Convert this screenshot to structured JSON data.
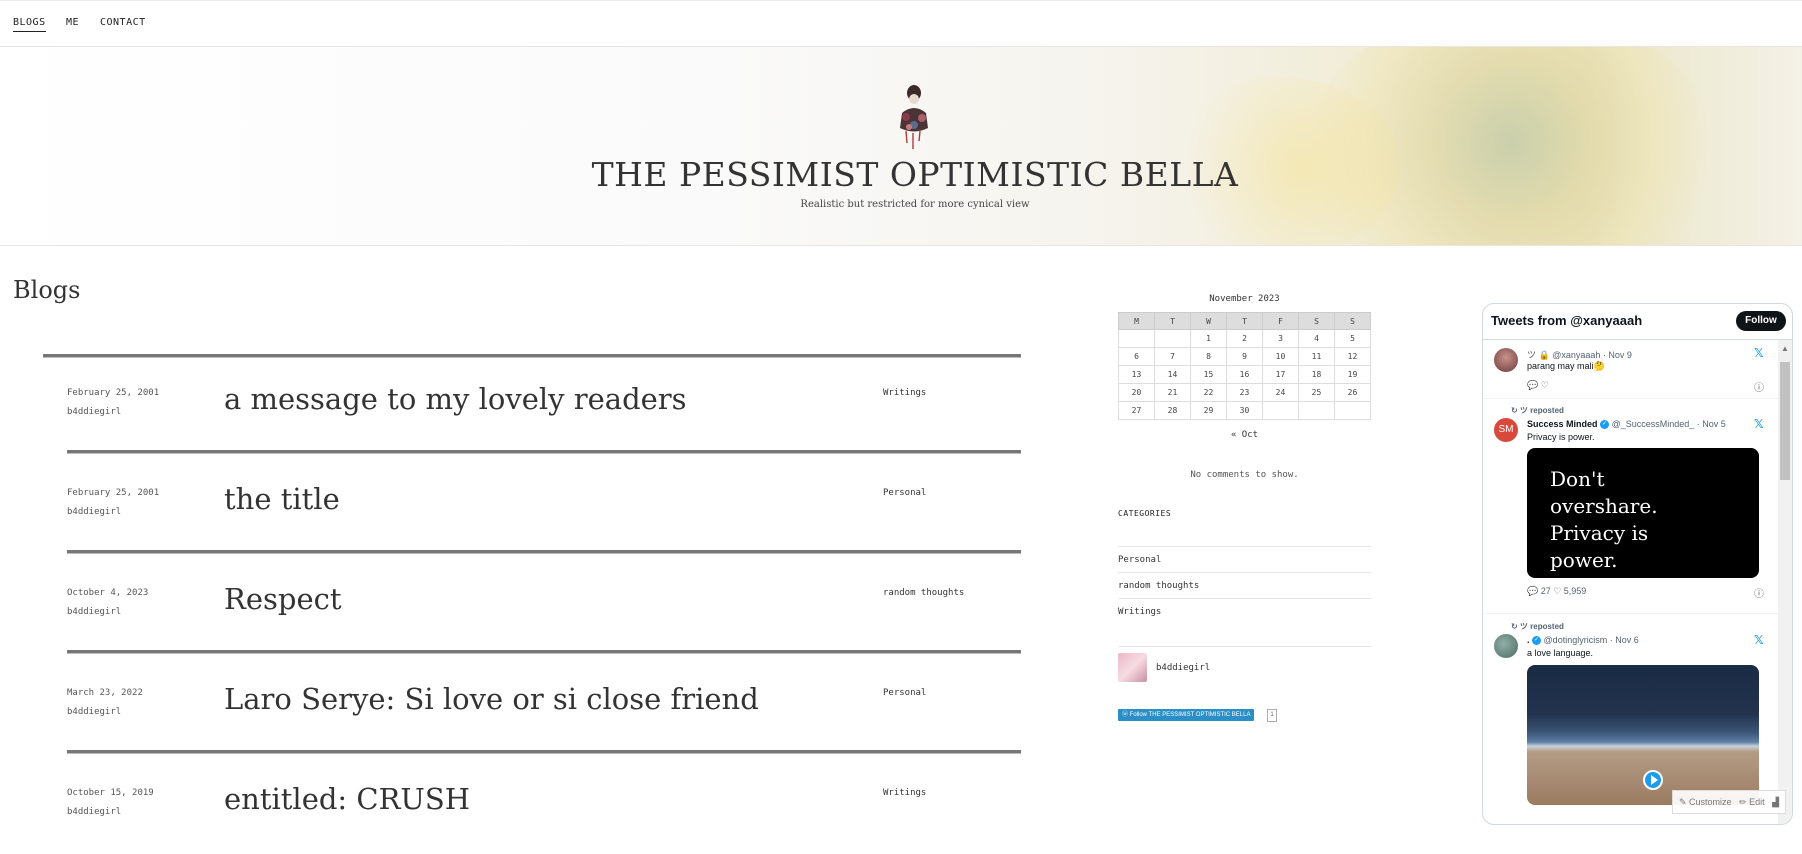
{
  "nav": {
    "items": [
      {
        "label": "BLOGS",
        "active": true
      },
      {
        "label": "ME",
        "active": false
      },
      {
        "label": "CONTACT",
        "active": false
      }
    ]
  },
  "site": {
    "title": "THE PESSIMIST OPTIMISTIC BELLA",
    "tagline": "Realistic but restricted for more cynical view"
  },
  "main": {
    "heading": "Blogs",
    "posts": [
      {
        "date": "February 25, 2001",
        "author": "b4ddiegirl",
        "title": "a message to my lovely readers",
        "category": "Writings"
      },
      {
        "date": "February 25, 2001",
        "author": "b4ddiegirl",
        "title": "the title",
        "category": "Personal"
      },
      {
        "date": "October 4, 2023",
        "author": "b4ddiegirl",
        "title": "Respect",
        "category": "random thoughts"
      },
      {
        "date": "March 23, 2022",
        "author": "b4ddiegirl",
        "title": "Laro Serye: Si love or si close friend",
        "category": "Personal"
      },
      {
        "date": "October 15, 2019",
        "author": "b4ddiegirl",
        "title": "entitled: CRUSH",
        "category": "Writings"
      }
    ]
  },
  "sidebar": {
    "calendar": {
      "caption": "November 2023",
      "weekdays": [
        "M",
        "T",
        "W",
        "T",
        "F",
        "S",
        "S"
      ],
      "weeks": [
        [
          "",
          "",
          "1",
          "2",
          "3",
          "4",
          "5"
        ],
        [
          "6",
          "7",
          "8",
          "9",
          "10",
          "11",
          "12"
        ],
        [
          "13",
          "14",
          "15",
          "16",
          "17",
          "18",
          "19"
        ],
        [
          "20",
          "21",
          "22",
          "23",
          "24",
          "25",
          "26"
        ],
        [
          "27",
          "28",
          "29",
          "30",
          "",
          "",
          ""
        ]
      ],
      "prev_link": "« Oct"
    },
    "comments_text": "No comments to show.",
    "categories_heading": "CATEGORIES",
    "categories": [
      "Personal",
      "random thoughts",
      "Writings"
    ],
    "author_name": "b4ddiegirl",
    "follow_button": "Follow THE PESSIMIST OPTIMISTIC BELLA",
    "follow_count": "1"
  },
  "twitter": {
    "title": "Tweets from @xanyaaah",
    "follow_label": "Follow",
    "tweets": [
      {
        "user_line": "ツ 🔒 @xanyaaah · Nov 9",
        "text": "parang may mali🤔",
        "actions": "💬 ♡"
      },
      {
        "repost_label": "↻ ツ reposted",
        "name": "Success Minded",
        "handle_line": "@_SuccessMinded_ · Nov 5",
        "text": "Privacy is power.",
        "card_text": "Don't overshare. Privacy is power.",
        "actions": "💬 27 ♡ 5,959",
        "avatar_text": "SM"
      },
      {
        "repost_label": "↻ ツ reposted",
        "name": ".",
        "handle_line": "@dotinglyricism · Nov 6",
        "text": "a love language."
      }
    ],
    "brand_icon": "x-logo-icon"
  },
  "overlay": {
    "customize": "Customize",
    "edit": "Edit"
  },
  "colors": {
    "twitter_blue": "#1d9bf0",
    "follow_blue": "#2b8fc7",
    "text_dark": "#333333"
  }
}
